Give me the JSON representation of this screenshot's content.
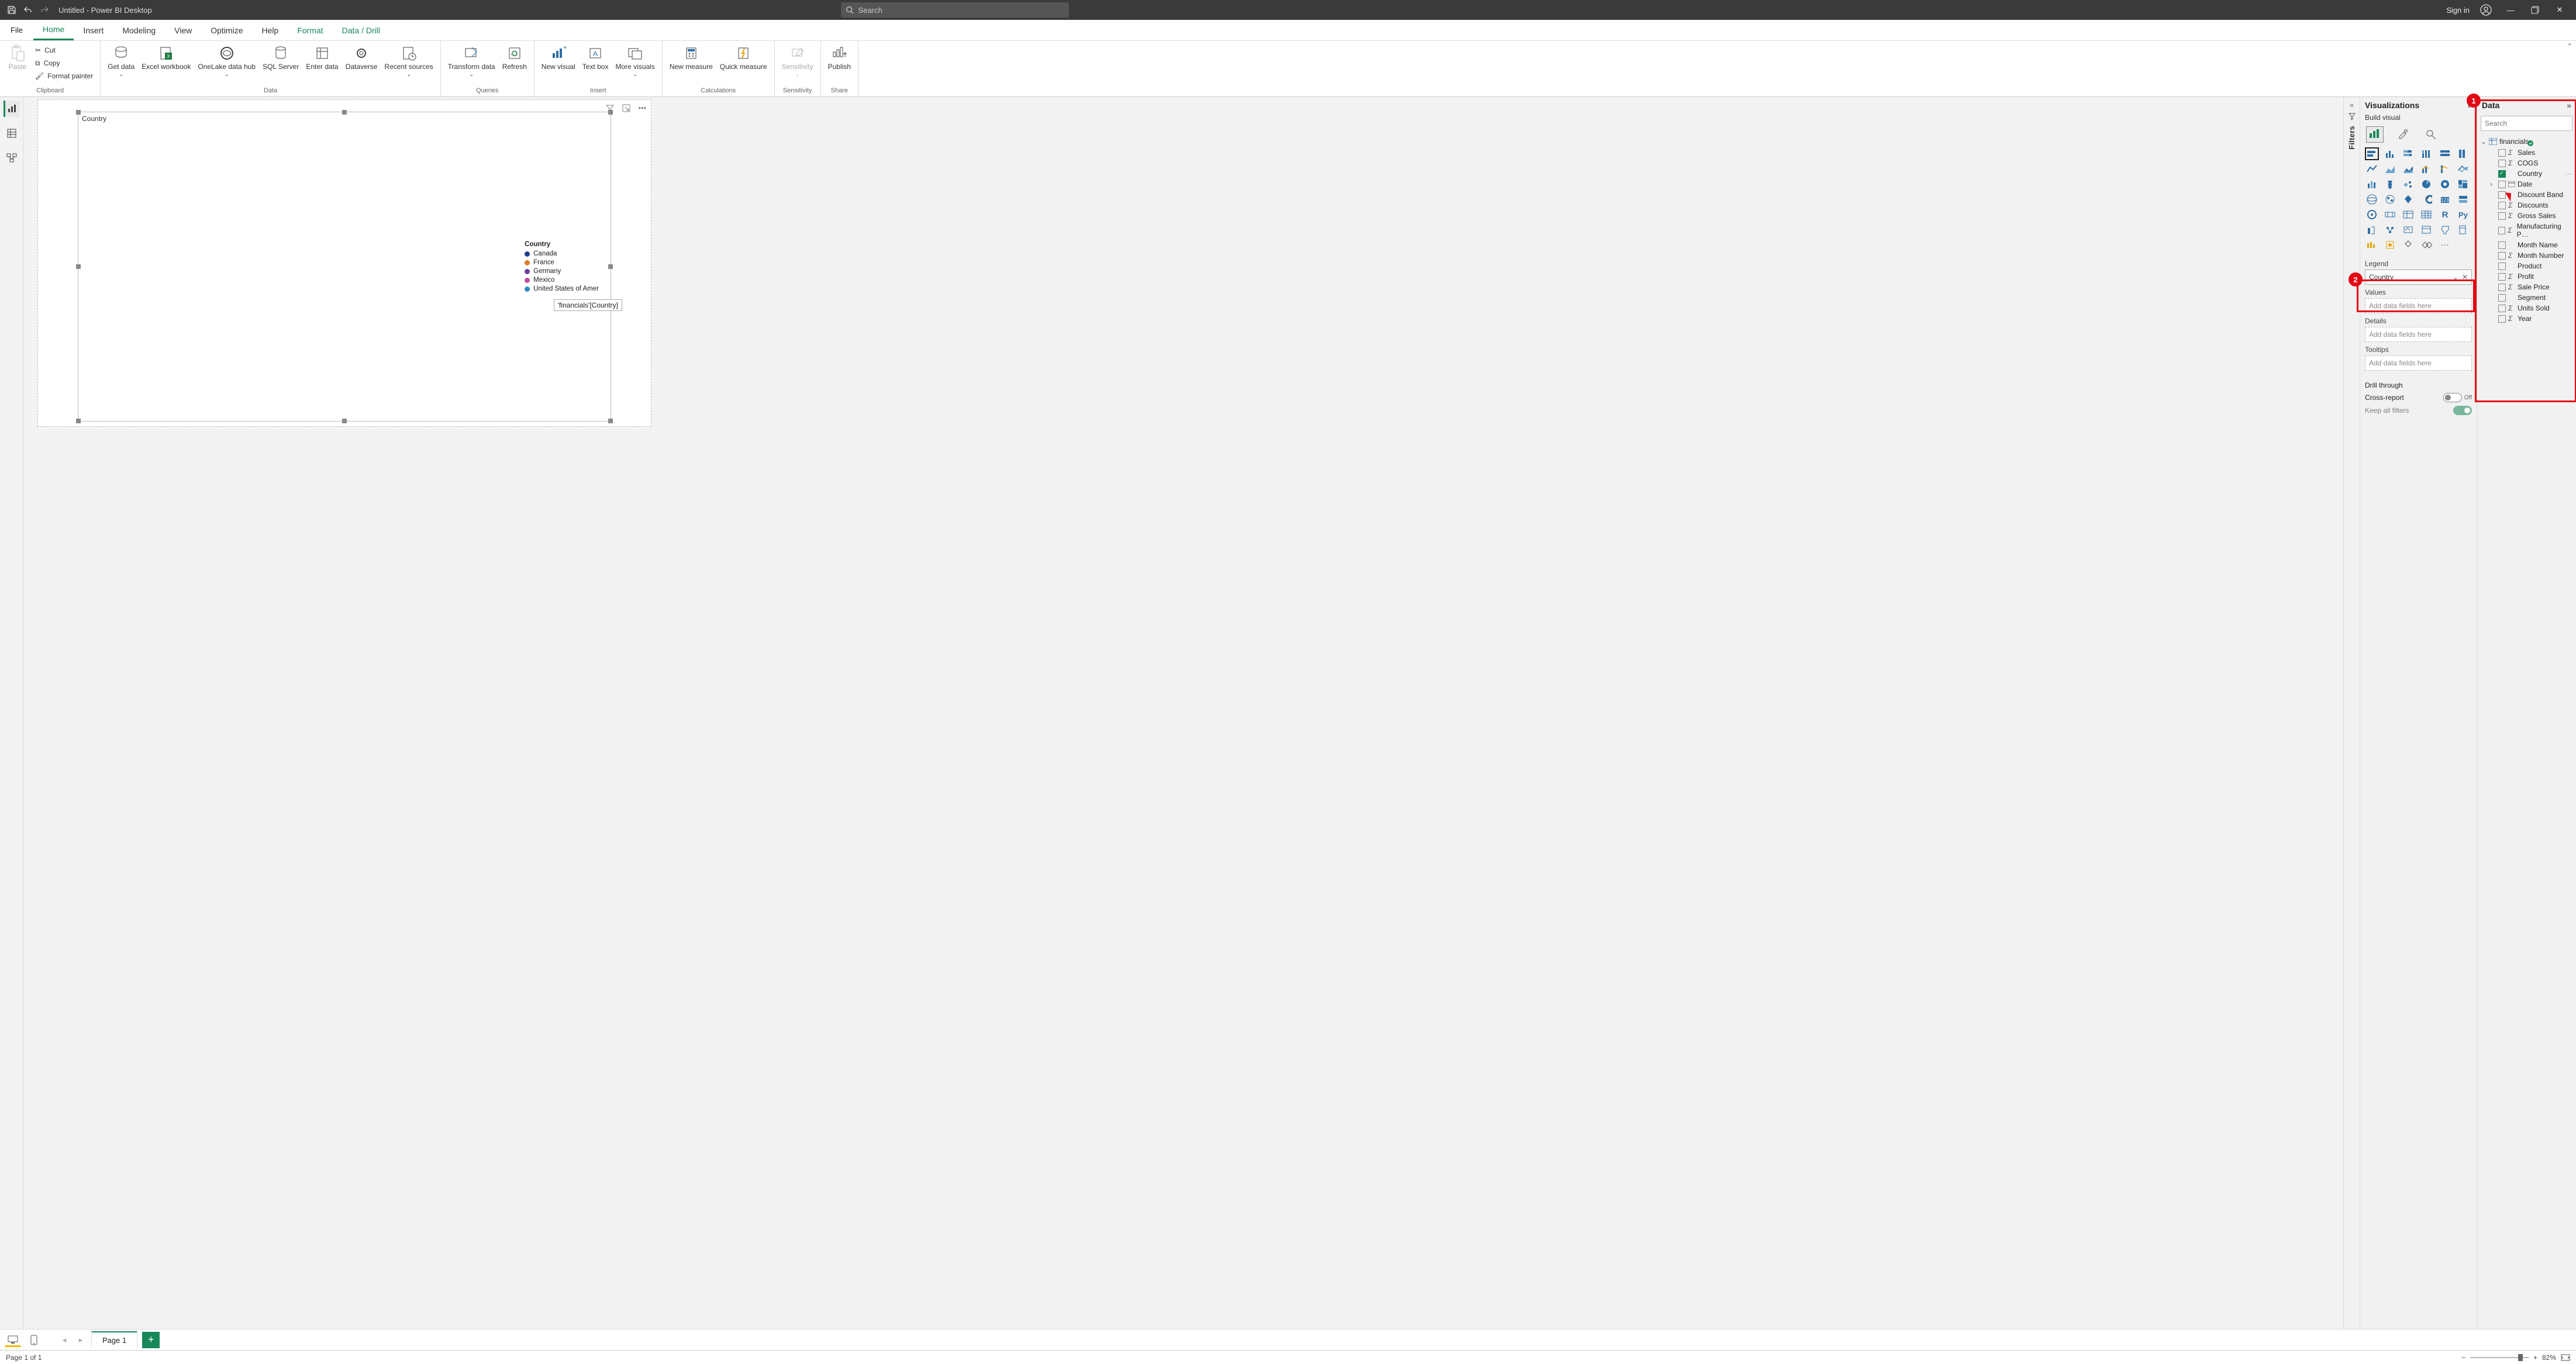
{
  "titlebar": {
    "title": "Untitled - Power BI Desktop",
    "search_placeholder": "Search",
    "signin": "Sign in"
  },
  "menu": {
    "file": "File",
    "tabs": [
      "Home",
      "Insert",
      "Modeling",
      "View",
      "Optimize",
      "Help",
      "Format",
      "Data / Drill"
    ],
    "active": "Home"
  },
  "ribbon": {
    "clipboard": {
      "label": "Clipboard",
      "paste": "Paste",
      "cut": "Cut",
      "copy": "Copy",
      "format_painter": "Format painter"
    },
    "data": {
      "label": "Data",
      "get_data": "Get data",
      "excel": "Excel workbook",
      "onelake": "OneLake data hub",
      "sql": "SQL Server",
      "enter": "Enter data",
      "dataverse": "Dataverse",
      "recent": "Recent sources"
    },
    "queries": {
      "label": "Queries",
      "transform": "Transform data",
      "refresh": "Refresh"
    },
    "insert": {
      "label": "Insert",
      "new_visual": "New visual",
      "text_box": "Text box",
      "more_visuals": "More visuals"
    },
    "calculations": {
      "label": "Calculations",
      "new_measure": "New measure",
      "quick_measure": "Quick measure"
    },
    "sensitivity": {
      "label": "Sensitivity",
      "btn": "Sensitivity"
    },
    "share": {
      "label": "Share",
      "publish": "Publish"
    }
  },
  "canvas": {
    "visual_title": "Country",
    "legend_title": "Country",
    "legend_items": [
      {
        "name": "Canada",
        "color": "#1f3c88"
      },
      {
        "name": "France",
        "color": "#d97b29"
      },
      {
        "name": "Germany",
        "color": "#6a3fa0"
      },
      {
        "name": "Mexico",
        "color": "#c44d9b"
      },
      {
        "name": "United States of Amer",
        "color": "#2e8bc0"
      }
    ],
    "field_tooltip": "'financials'[Country]"
  },
  "viz": {
    "title": "Visualizations",
    "build": "Build visual",
    "wells": {
      "legend": "Legend",
      "legend_value": "Country",
      "values": "Values",
      "values_ph": "Add data fields here",
      "details": "Details",
      "details_ph": "Add data fields here",
      "tooltips": "Tooltips",
      "tooltips_ph": "Add data fields here"
    },
    "drill": {
      "title": "Drill through",
      "cross": "Cross-report",
      "cross_state": "Off",
      "keep": "Keep all filters"
    }
  },
  "filters": {
    "title": "Filters"
  },
  "data": {
    "title": "Data",
    "search_ph": "Search",
    "table": "financials",
    "fields": [
      {
        "name": "Sales",
        "sigma": true,
        "checked": false
      },
      {
        "name": "COGS",
        "sigma": true,
        "checked": false
      },
      {
        "name": "Country",
        "sigma": false,
        "checked": true
      },
      {
        "name": "Date",
        "sigma": false,
        "checked": false,
        "expandable": true
      },
      {
        "name": "Discount Band",
        "sigma": false,
        "checked": false
      },
      {
        "name": "Discounts",
        "sigma": true,
        "checked": false
      },
      {
        "name": "Gross Sales",
        "sigma": true,
        "checked": false
      },
      {
        "name": "Manufacturing P…",
        "sigma": true,
        "checked": false
      },
      {
        "name": "Month Name",
        "sigma": false,
        "checked": false
      },
      {
        "name": "Month Number",
        "sigma": true,
        "checked": false
      },
      {
        "name": "Product",
        "sigma": false,
        "checked": false
      },
      {
        "name": "Profit",
        "sigma": true,
        "checked": false
      },
      {
        "name": "Sale Price",
        "sigma": true,
        "checked": false
      },
      {
        "name": "Segment",
        "sigma": false,
        "checked": false
      },
      {
        "name": "Units Sold",
        "sigma": true,
        "checked": false
      },
      {
        "name": "Year",
        "sigma": true,
        "checked": false
      }
    ]
  },
  "pagebar": {
    "page": "Page 1"
  },
  "status": {
    "page_info": "Page 1 of 1",
    "zoom": "82%"
  }
}
